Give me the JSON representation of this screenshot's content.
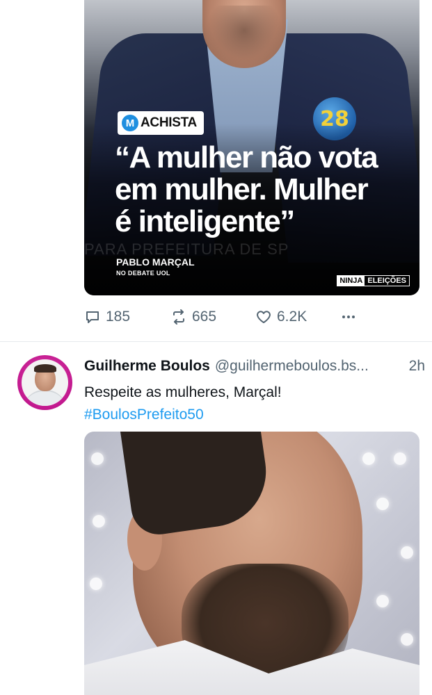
{
  "tweet1": {
    "media": {
      "tag_letter": "M",
      "tag_text": "ACHISTA",
      "badge_number": "28",
      "quote_lines": [
        "“A mulher não vota",
        "em mulher. Mulher",
        "é inteligente”"
      ],
      "background_text": "PARA PREFEITURA DE SP",
      "speaker": "PABLO MARÇAL",
      "speaker_sub": "NO DEBATE UOL",
      "brand_left": "NINJA",
      "brand_right": "ELEIÇÕES"
    },
    "actions": {
      "replies": "185",
      "retweets": "665",
      "likes": "6.2K"
    }
  },
  "tweet2": {
    "name": "Guilherme Boulos",
    "handle": "@guilhermeboulos.bs...",
    "time": "2h",
    "text": "Respeite as mulheres, Marçal!",
    "hashtag": "#BoulosPrefeito50"
  },
  "colors": {
    "link": "#1d9bf0",
    "muted": "#536471",
    "text": "#0f1419",
    "avatar_ring": "#c2188e"
  },
  "icons": [
    "reply-icon",
    "retweet-icon",
    "like-icon",
    "more-icon"
  ]
}
